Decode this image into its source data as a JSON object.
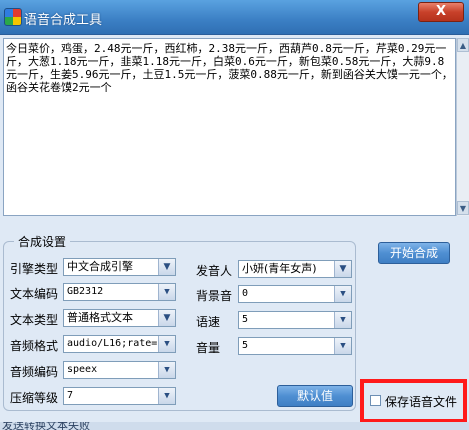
{
  "window": {
    "title": "语音合成工具",
    "close_label": "X"
  },
  "textarea": {
    "content": "今日菜价，鸡蛋，2.48元一斤，西红柿，2.38元一斤，西葫芦0.8元一斤，芹菜0.29元一斤，大葱1.18元一斤，韭菜1.18元一斤，白菜0.6元一斤，新包菜0.58元一斤，大蒜9.8元一斤，生姜5.96元一斤，土豆1.5元一斤，菠菜0.88元一斤，新到函谷关大馍一元一个，函谷关花卷馍2元一个"
  },
  "synthesis_button": "开始合成",
  "settings": {
    "group_title": "合成设置",
    "engine_type": {
      "label": "引擎类型",
      "value": "中文合成引擎"
    },
    "text_encoding": {
      "label": "文本编码",
      "value": "GB2312"
    },
    "text_type": {
      "label": "文本类型",
      "value": "普通格式文本"
    },
    "audio_format": {
      "label": "音频格式",
      "value": "audio/L16;rate="
    },
    "audio_encoding": {
      "label": "音频编码",
      "value": "speex"
    },
    "compression_level": {
      "label": "压缩等级",
      "value": "7"
    },
    "speaker": {
      "label": "发音人",
      "value": "小妍(青年女声)"
    },
    "background_sound": {
      "label": "背景音",
      "value": "0"
    },
    "speed": {
      "label": "语速",
      "value": "5"
    },
    "volume": {
      "label": "音量",
      "value": "5"
    },
    "default_button": "默认值"
  },
  "save_audio": {
    "label": "保存语音文件",
    "checked": false
  },
  "status_text": "发送转换文本失败",
  "colors": {
    "highlight_border": "#ff1a1a",
    "title_bar": "#3b7fc4"
  }
}
